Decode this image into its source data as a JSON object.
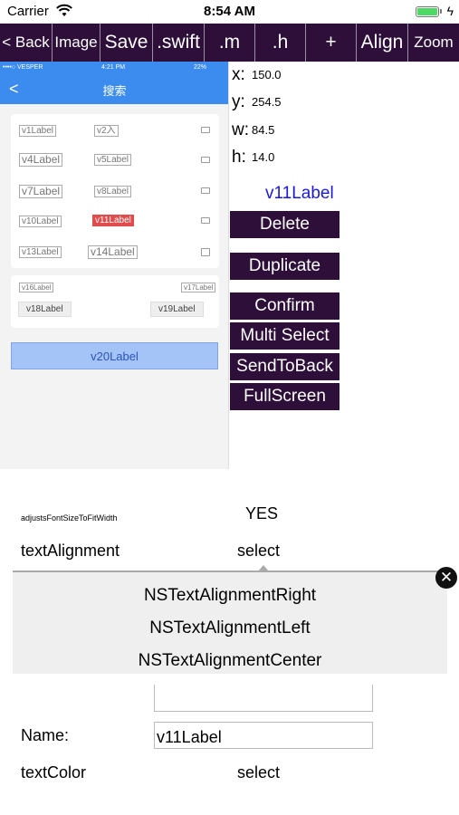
{
  "status_bar": {
    "carrier": "Carrier",
    "time": "8:54 AM"
  },
  "toolbar": {
    "buttons": [
      "< Back",
      "Image",
      "Save",
      ".swift",
      ".m",
      ".h",
      "+",
      "Align",
      "Zoom"
    ]
  },
  "preview": {
    "status_carrier": "••••○ VESPER",
    "status_time": "4:21 PM",
    "status_battery": "22%",
    "nav_back": "<",
    "nav_title": "搜索",
    "card1_labels": [
      "v1Label",
      "v2入",
      "v4Label",
      "v5Label",
      "v7Label",
      "v8Label",
      "v10Label",
      "v11Label",
      "v13Label",
      "v14Label"
    ],
    "card2_labels": [
      "v16Label",
      "v17Label",
      "v18Label",
      "v19Label"
    ],
    "button_label": "v20Label"
  },
  "coords": {
    "x_label": "x:",
    "x": "150.0",
    "y_label": "y:",
    "y": "254.5",
    "w_label": "w:",
    "w": "84.5",
    "h_label": "h:",
    "h": "14.0"
  },
  "selected_name": "v11Label",
  "actions": [
    "Delete",
    "Duplicate",
    "Confirm",
    "Multi Select",
    "SendToBack",
    "FullScreen"
  ],
  "props": {
    "adjusts_label": "adjustsFontSizeToFitWidth",
    "adjusts_value": "YES",
    "alignment_label": "textAlignment",
    "alignment_value": "select",
    "name_label": "Name:",
    "name_value": "v11Label",
    "color_label": "textColor",
    "color_value": "select"
  },
  "picker": {
    "options": [
      "NSTextAlignmentRight",
      "NSTextAlignmentLeft",
      "NSTextAlignmentCenter"
    ],
    "close": "✕"
  },
  "colors": {
    "toolbar": "#2d0f3a",
    "preview_nav": "#3c8cf0",
    "selected_name": "#1a1ad6"
  }
}
